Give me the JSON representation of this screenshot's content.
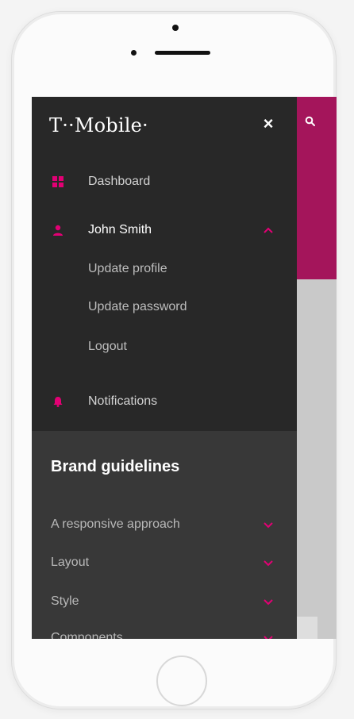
{
  "brand": {
    "logo_text": "T··Mobile·",
    "accent": "#e20074"
  },
  "drawer": {
    "close_label": "×",
    "items": [
      {
        "label": "Dashboard",
        "icon": "grid-icon"
      },
      {
        "label": "John Smith",
        "icon": "user-icon",
        "expanded": true
      },
      {
        "label": "Notifications",
        "icon": "bell-icon"
      }
    ],
    "account_submenu": [
      {
        "label": "Update profile"
      },
      {
        "label": "Update password"
      },
      {
        "label": "Logout"
      }
    ]
  },
  "brand_guidelines": {
    "title": "Brand guidelines",
    "items": [
      {
        "label": "A responsive approach"
      },
      {
        "label": "Layout"
      },
      {
        "label": "Style"
      },
      {
        "label": "Components"
      }
    ]
  }
}
